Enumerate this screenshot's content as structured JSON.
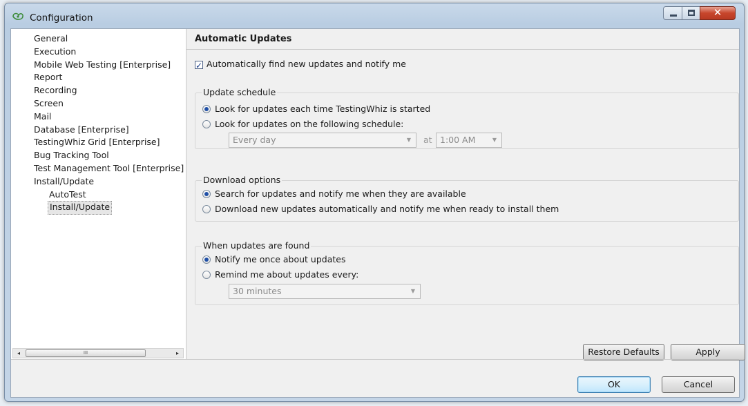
{
  "window": {
    "title": "Configuration",
    "close_glyph": "✕"
  },
  "tree": {
    "items": [
      {
        "label": "General",
        "level": 0,
        "selected": false
      },
      {
        "label": "Execution",
        "level": 0,
        "selected": false
      },
      {
        "label": "Mobile Web Testing [Enterprise]",
        "level": 0,
        "selected": false
      },
      {
        "label": "Report",
        "level": 0,
        "selected": false
      },
      {
        "label": "Recording",
        "level": 0,
        "selected": false
      },
      {
        "label": "Screen",
        "level": 0,
        "selected": false
      },
      {
        "label": "Mail",
        "level": 0,
        "selected": false
      },
      {
        "label": "Database [Enterprise]",
        "level": 0,
        "selected": false
      },
      {
        "label": "TestingWhiz Grid [Enterprise]",
        "level": 0,
        "selected": false
      },
      {
        "label": "Bug Tracking Tool",
        "level": 0,
        "selected": false
      },
      {
        "label": "Test Management Tool [Enterprise]",
        "level": 0,
        "selected": false
      },
      {
        "label": "Install/Update",
        "level": 0,
        "selected": false
      },
      {
        "label": "AutoTest",
        "level": 1,
        "selected": false
      },
      {
        "label": "Install/Update",
        "level": 1,
        "selected": true
      }
    ],
    "scroll_left": "◂",
    "scroll_right": "▸",
    "scroll_grip": "III"
  },
  "panel": {
    "title": "Automatic Updates",
    "auto_find": {
      "label": "Automatically find new updates and notify me",
      "checked": true,
      "mark": "✓"
    },
    "schedule": {
      "label": "Update schedule",
      "options": [
        {
          "label": "Look for updates each time TestingWhiz is started",
          "selected": true
        },
        {
          "label": "Look for updates on the following schedule:",
          "selected": false
        }
      ],
      "frequency": "Every day",
      "at_label": "at",
      "time": "1:00 AM"
    },
    "download": {
      "label": "Download options",
      "options": [
        {
          "label": "Search for updates and notify me when they are available",
          "selected": true
        },
        {
          "label": "Download new updates automatically and notify me when ready to install them",
          "selected": false
        }
      ]
    },
    "found": {
      "label": "When updates are found",
      "options": [
        {
          "label": "Notify me once about updates",
          "selected": true
        },
        {
          "label": "Remind me about updates every:",
          "selected": false
        }
      ],
      "interval": "30 minutes"
    },
    "restore_label": "Restore Defaults",
    "apply_label": "Apply"
  },
  "footer": {
    "ok_label": "OK",
    "cancel_label": "Cancel"
  },
  "combo_arrow": "▼"
}
